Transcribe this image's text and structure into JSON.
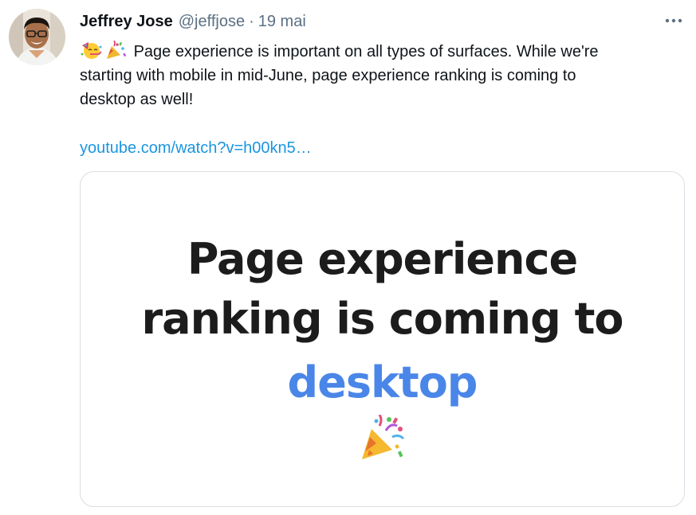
{
  "tweet": {
    "author": {
      "name": "Jeffrey Jose",
      "handle": "@jeffjose",
      "separator": "·",
      "date": "19 mai",
      "avatar_icon": "avatar-photo"
    },
    "more_icon": "more-options-icon",
    "text_emojis": [
      "partying-face-icon",
      "party-popper-icon"
    ],
    "text_line_1": "Page experience is important on all types of surfaces. While we're",
    "text_line_2": "starting with mobile in mid-June, page experience ranking is coming to",
    "text_line_3": "desktop as well!",
    "link": "youtube.com/watch?v=h00kn5…",
    "link_color": "#1b95e0",
    "media_card": {
      "line_1": "Page experience",
      "line_2": "ranking is coming to",
      "line_3": "desktop",
      "line_3_color": "#4a86e8",
      "emoji": "party-popper-icon"
    }
  }
}
